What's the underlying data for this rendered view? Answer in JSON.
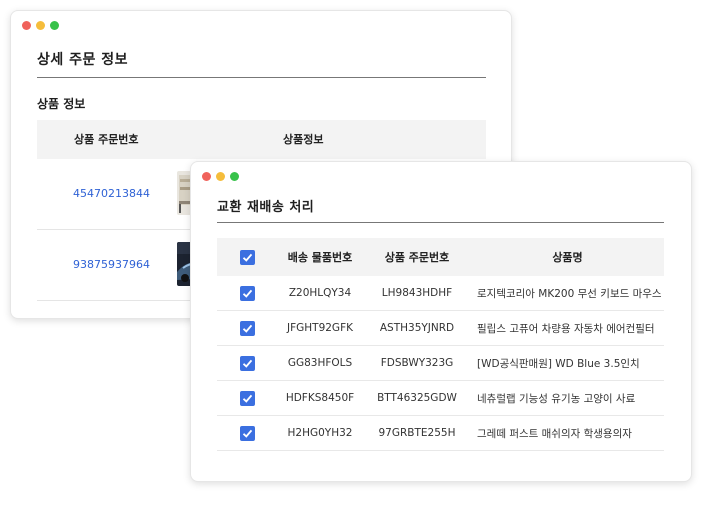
{
  "order_detail": {
    "title": "상세 주문 정보",
    "section": "상품 정보",
    "columns": [
      "상품 주문번호",
      "상품정보"
    ],
    "rows": [
      {
        "order_no": "45470213844",
        "thumb": "furniture-thumbnail"
      },
      {
        "order_no": "93875937964",
        "thumb": "car-thumbnail"
      }
    ]
  },
  "exchange": {
    "title": "교환 재배송 처리",
    "columns": [
      "배송 물품번호",
      "상품 주문번호",
      "상품명"
    ],
    "header_checked": true,
    "rows": [
      {
        "checked": true,
        "ship_no": "Z20HLQY34",
        "order_no": "LH9843HDHF",
        "name": "로지텍코리아 MK200 무선 키보드 마우스"
      },
      {
        "checked": true,
        "ship_no": "JFGHT92GFK",
        "order_no": "ASTH35YJNRD",
        "name": "필립스 고퓨어 차량용 자동차 에어컨필터"
      },
      {
        "checked": true,
        "ship_no": "GG83HFOLS",
        "order_no": "FDSBWY323G",
        "name": "[WD공식판매원] WD Blue 3.5인치"
      },
      {
        "checked": true,
        "ship_no": "HDFKS8450F",
        "order_no": "BTT46325GDW",
        "name": "네츄럴랩 기능성 유기농 고양이 사료"
      },
      {
        "checked": true,
        "ship_no": "H2HG0YH32",
        "order_no": "97GRBTE255H",
        "name": "그레떼 퍼스트 매쉬의자 학생용의자"
      }
    ]
  },
  "colors": {
    "accent": "#3b6fe0",
    "link": "#2f62d5",
    "header_bg": "#f3f3f3",
    "window_dots": [
      "#f0625b",
      "#f5bd3b",
      "#38c24a"
    ]
  }
}
